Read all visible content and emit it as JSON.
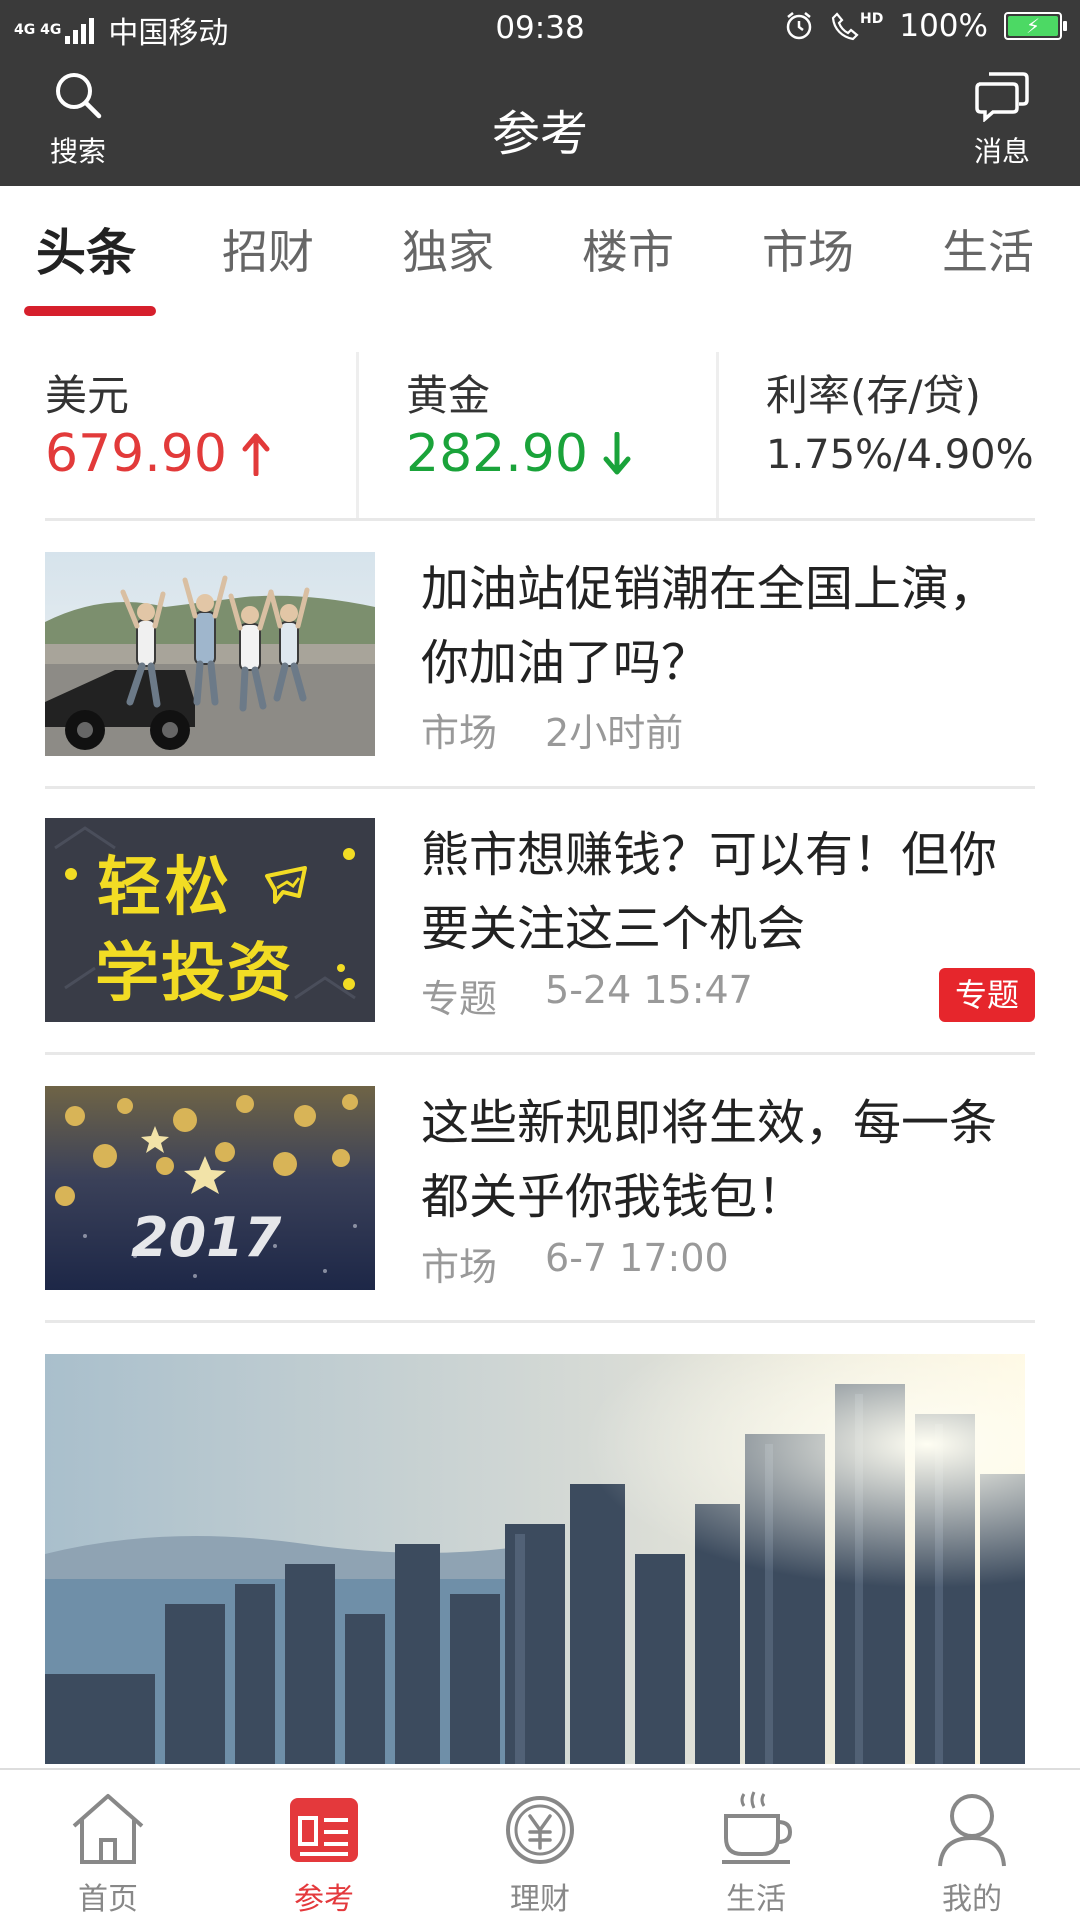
{
  "status_bar": {
    "network": "4G 4G",
    "carrier": "中国移动",
    "time": "09:38",
    "volte": "HD",
    "battery": "100%"
  },
  "header": {
    "title": "参考",
    "search_label": "搜索",
    "message_label": "消息",
    "bg_color": "#3a3a3a"
  },
  "tabs": [
    {
      "label": "头条",
      "active": true
    },
    {
      "label": "招财"
    },
    {
      "label": "独家"
    },
    {
      "label": "楼市"
    },
    {
      "label": "市场"
    },
    {
      "label": "生活"
    }
  ],
  "market": [
    {
      "label": "美元",
      "value": "679.90",
      "trend": "up",
      "arrow": "↑"
    },
    {
      "label": "黄金",
      "value": "282.90",
      "trend": "down",
      "arrow": "↓"
    },
    {
      "label": "利率(存/贷)",
      "value": "1.75%/4.90%"
    }
  ],
  "news": [
    {
      "title": "加油站促销潮在全国上演，你加油了吗？",
      "category": "市场",
      "time": "2小时前"
    },
    {
      "title": "熊市想赚钱？可以有！但你要关注这三个机会",
      "category": "专题",
      "time": "5-24 15:47",
      "badge": "专题",
      "thumb_text_1": "轻松",
      "thumb_text_2": "学投资"
    },
    {
      "title": "这些新规即将生效，每一条都关乎你我钱包！",
      "category": "市场",
      "time": "6-7 17:00",
      "thumb_text": "2017"
    }
  ],
  "bottom_nav": [
    {
      "label": "首页",
      "icon": "home-icon"
    },
    {
      "label": "参考",
      "icon": "news-icon",
      "active": true
    },
    {
      "label": "理财",
      "icon": "yuan-coin-icon"
    },
    {
      "label": "生活",
      "icon": "cup-icon"
    },
    {
      "label": "我的",
      "icon": "user-icon"
    }
  ],
  "colors": {
    "accent": "#e4393c",
    "up": "#e23a3a",
    "down": "#1aa33a",
    "badge": "#e6262c"
  }
}
